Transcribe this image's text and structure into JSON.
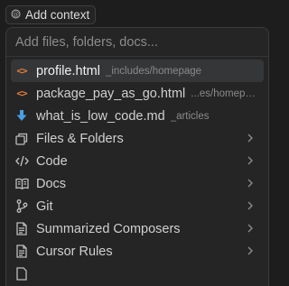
{
  "add_context": {
    "icon": "at-icon",
    "label": "Add context"
  },
  "search": {
    "placeholder": "Add files, folders, docs..."
  },
  "files": [
    {
      "name": "profile.html",
      "path": "_includes/homepage",
      "icon": "html-code-icon",
      "selected": true
    },
    {
      "name": "package_pay_as_go.html",
      "path": "...es/homepage",
      "icon": "html-code-icon"
    },
    {
      "name": "what_is_low_code.md",
      "path": "_articles",
      "icon": "markdown-download-icon"
    }
  ],
  "categories": [
    {
      "label": "Files & Folders",
      "icon": "folder-stack-icon"
    },
    {
      "label": "Code",
      "icon": "code-brackets-icon"
    },
    {
      "label": "Docs",
      "icon": "book-icon"
    },
    {
      "label": "Git",
      "icon": "git-branch-icon"
    },
    {
      "label": "Summarized Composers",
      "icon": "document-icon"
    },
    {
      "label": "Cursor Rules",
      "icon": "document-icon"
    }
  ],
  "colors": {
    "html_icon": "#e27d3b",
    "md_icon": "#4a9fe0",
    "selected_bg": "#353638"
  }
}
